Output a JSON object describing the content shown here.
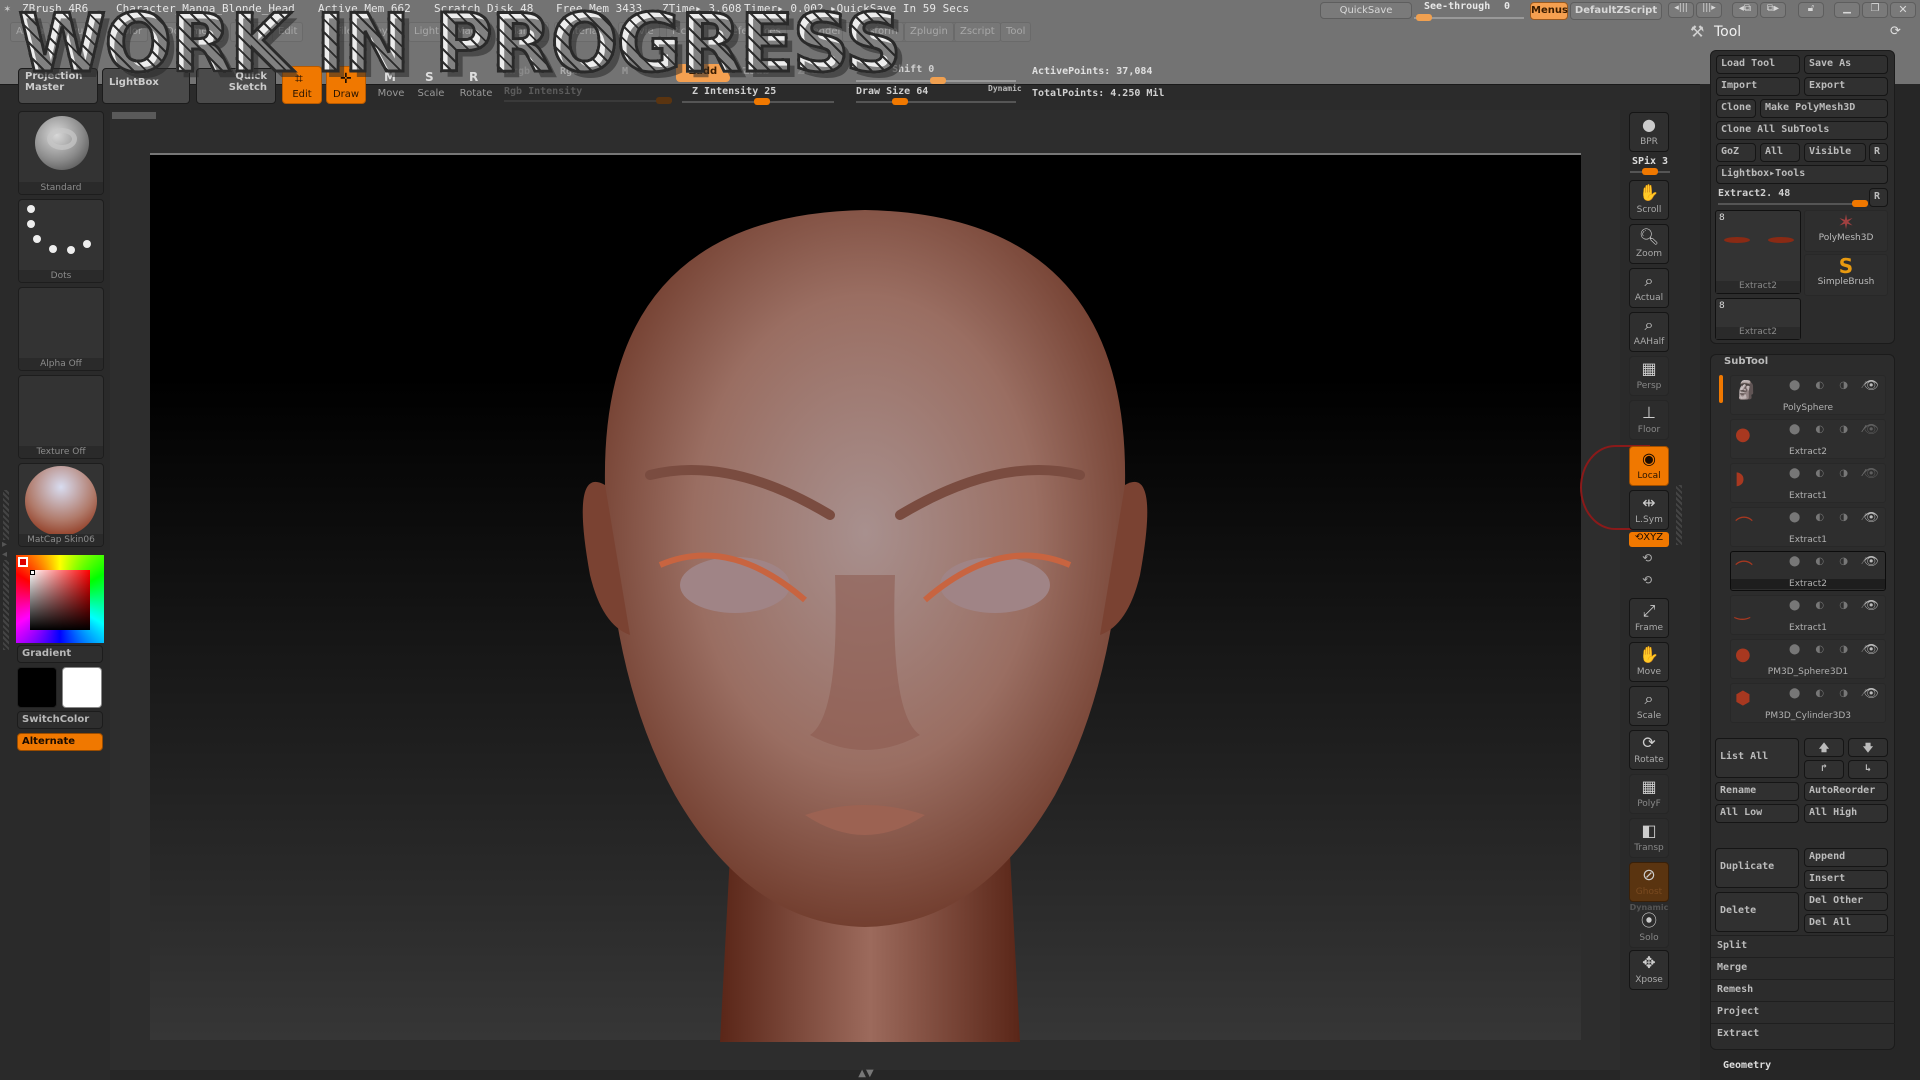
{
  "app": {
    "name": "ZBrush 4R6",
    "document": "Character_Manga_Blonde_Head",
    "stats": [
      "Active Mem 662",
      "Scratch Disk 48",
      "Free Mem 3433",
      "ZTime▸ 3.608",
      "Timer▸ 0.002",
      "▸QuickSave In 59 Secs"
    ],
    "watermark": "WORK IN PROGRESS"
  },
  "menus": [
    "Alpha",
    "Brush",
    "Color",
    "Document",
    "Draw",
    "Edit",
    "File",
    "Layer",
    "Light",
    "Macro",
    "Marker",
    "Material",
    "Movie",
    "Picker",
    "Preferences",
    "Render",
    "Stencil",
    "Stroke",
    "Texture",
    "Tool",
    "Transform",
    "Zplugin",
    "Zscript"
  ],
  "topright": {
    "quicksave": "QuickSave",
    "seethrough_label": "See-through",
    "seethrough_value": "0",
    "menus": "Menus",
    "default_script": "DefaultZScript"
  },
  "toolbar": {
    "projection_master": [
      "Projection",
      "Master"
    ],
    "lightbox": "LightBox",
    "quick_sketch": [
      "Quick",
      "Sketch"
    ],
    "edit": "Edit",
    "draw": "Draw",
    "move": "Move",
    "scale": "Scale",
    "rotate": "Rotate",
    "mrgb": "Mrgb",
    "rgb": "Rgb",
    "m": "M",
    "rgb_intensity": "Rgb Intensity",
    "zadd": "Zadd",
    "zsub": "Zsub",
    "zcut": "Zcut",
    "z_intensity_label": "Z Intensity",
    "z_intensity": 25,
    "focal_shift_label": "Focal Shift",
    "focal_shift": 0,
    "draw_size_label": "Draw Size",
    "draw_size": 64,
    "dynamic": "Dynamic",
    "active_points": "ActivePoints: 37,084",
    "total_points": "TotalPoints: 4.250 Mil"
  },
  "left_shelf": {
    "brush": "Standard",
    "stroke": "Dots",
    "alpha": "Alpha Off",
    "texture": "Texture Off",
    "material": "MatCap Skin06",
    "gradient": "Gradient",
    "switch_color": "SwitchColor",
    "alternate": "Alternate",
    "main_color": "#ff0000",
    "secondary_color": "#ffffff"
  },
  "right_shelf": [
    {
      "id": "bpr",
      "label": "BPR",
      "icon": "sphere-icon"
    },
    {
      "id": "scroll",
      "label": "Scroll",
      "icon": "hand-icon"
    },
    {
      "id": "zoom",
      "label": "Zoom",
      "icon": "magnifier-icon"
    },
    {
      "id": "actual",
      "label": "Actual",
      "icon": "magnifier-x1-icon"
    },
    {
      "id": "aahalf",
      "label": "AAHalf",
      "icon": "magnifier-half-icon"
    },
    {
      "id": "persp",
      "label": "Persp",
      "icon": "grid-perspective-icon"
    },
    {
      "id": "floor",
      "label": "Floor",
      "icon": "floor-icon"
    },
    {
      "id": "local",
      "label": "Local",
      "icon": "local-icon",
      "active": true
    },
    {
      "id": "lsym",
      "label": "L.Sym",
      "icon": "symmetry-icon"
    },
    {
      "id": "frame",
      "label": "Frame",
      "icon": "frame-icon"
    },
    {
      "id": "move",
      "label": "Move",
      "icon": "hand-sphere-icon"
    },
    {
      "id": "scale",
      "label": "Scale",
      "icon": "magnifier-sphere-icon"
    },
    {
      "id": "rotate",
      "label": "Rotate",
      "icon": "rotate-icon"
    },
    {
      "id": "polyf",
      "label": "PolyF",
      "icon": "polyframe-icon"
    },
    {
      "id": "transp",
      "label": "Transp",
      "icon": "transparency-icon"
    },
    {
      "id": "ghost",
      "label": "Ghost",
      "icon": "ghost-icon"
    },
    {
      "id": "solo",
      "label": "Solo",
      "icon": "solo-icon"
    },
    {
      "id": "xpose",
      "label": "Xpose",
      "icon": "xpose-icon"
    }
  ],
  "right_shelf_extra": {
    "spix": "SPix 3",
    "xyz": "XYZ",
    "dynamic": "Dynamic"
  },
  "tool_panel": {
    "title": "Tool",
    "load_tool": "Load Tool",
    "save_as": "Save As",
    "import": "Import",
    "export": "Export",
    "clone": "Clone",
    "make_polymesh": "Make PolyMesh3D",
    "clone_all": "Clone All SubTools",
    "goz": "GoZ",
    "all": "All",
    "visible": "Visible",
    "r": "R",
    "lightbox_tools": "Lightbox▸Tools",
    "current_tool": "Extract2. 48",
    "thumbs": [
      {
        "label": "Extract2",
        "count": "8"
      },
      {
        "label": "PolyMesh3D"
      },
      {
        "label": "SimpleBrush"
      },
      {
        "label": "Extract2",
        "count": "8"
      }
    ],
    "subtool_title": "SubTool",
    "subtools": [
      {
        "name": "PolySphere",
        "visible": true
      },
      {
        "name": "Extract2",
        "visible": false
      },
      {
        "name": "Extract1",
        "visible": false
      },
      {
        "name": "Extract1",
        "visible": true
      },
      {
        "name": "Extract2",
        "visible": true,
        "selected": true
      },
      {
        "name": "Extract1",
        "visible": true
      },
      {
        "name": "PM3D_Sphere3D1",
        "visible": true
      },
      {
        "name": "PM3D_Cylinder3D3",
        "visible": true
      }
    ],
    "list_all": "List All",
    "rename": "Rename",
    "auto_reorder": "AutoReorder",
    "all_low": "All Low",
    "all_high": "All High",
    "duplicate": "Duplicate",
    "append": "Append",
    "insert": "Insert",
    "delete": "Delete",
    "del_other": "Del Other",
    "del_all": "Del All",
    "sections": [
      "Split",
      "Merge",
      "Remesh",
      "Project",
      "Extract"
    ],
    "geometry": "Geometry"
  }
}
